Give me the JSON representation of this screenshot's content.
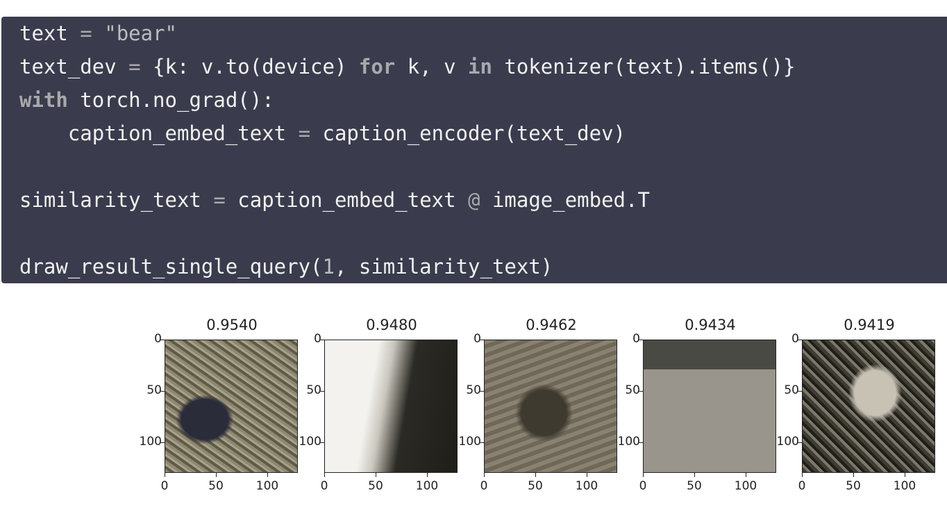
{
  "code": {
    "line1": {
      "var": "text",
      "op": " = ",
      "str": "\"bear\""
    },
    "line2": {
      "a": "text_dev",
      "op": " = ",
      "b": "{k: v.to(device) ",
      "kw1": "for",
      "c": " k, v ",
      "kw2": "in",
      "d": " tokenizer(text).items()}"
    },
    "line3": {
      "kw": "with",
      "rest": " torch.no_grad():"
    },
    "line4": {
      "a": "    caption_embed_text",
      "op": " = ",
      "b": "caption_encoder(text_dev)"
    },
    "line5": {
      "a": "similarity_text",
      "op": " = ",
      "b": "caption_embed_text ",
      "op2": "@",
      "c": " image_embed.T"
    },
    "line6": {
      "a": "draw_result_single_query(",
      "num": "1",
      "b": ", similarity_text)"
    }
  },
  "results": [
    {
      "score": "0.9540",
      "image": "otter-on-grass"
    },
    {
      "score": "0.9480",
      "image": "white-animal-closeup"
    },
    {
      "score": "0.9462",
      "image": "otters-in-water"
    },
    {
      "score": "0.9434",
      "image": "small-animal-on-pavement"
    },
    {
      "score": "0.9419",
      "image": "dog-face-closeup"
    }
  ],
  "axis": {
    "y_ticks": [
      "0",
      "50",
      "100"
    ],
    "x_ticks": [
      "0",
      "50",
      "100"
    ]
  }
}
